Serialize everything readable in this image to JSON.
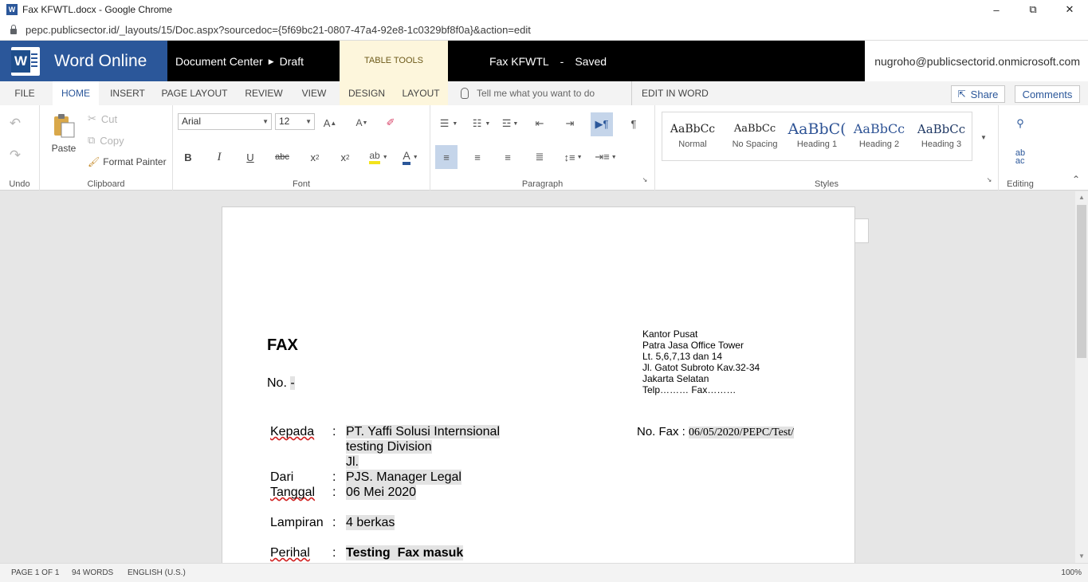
{
  "browser": {
    "tab_title": "Fax KFWTL.docx - Google Chrome",
    "url": "pepc.publicsector.id/_layouts/15/Doc.aspx?sourcedoc={5f69bc21-0807-47a4-92e8-1c0329bf8f0a}&action=edit",
    "minimize": "–",
    "restore": "⧉",
    "close": "✕"
  },
  "header": {
    "app_name": "Word Online",
    "logo_letter": "W",
    "breadcrumb": [
      "Document Center",
      "Draft"
    ],
    "table_tools": "TABLE TOOLS",
    "doc_name": "Fax KFWTL",
    "dash": "-",
    "save_status": "Saved",
    "user": "nugroho@publicsectorid.onmicrosoft.com"
  },
  "tabs": {
    "file": "FILE",
    "home": "HOME",
    "insert": "INSERT",
    "page_layout": "PAGE LAYOUT",
    "review": "REVIEW",
    "view": "VIEW",
    "design": "DESIGN",
    "layout": "LAYOUT",
    "tell_me": "Tell me what you want to do",
    "edit_in_word": "EDIT IN WORD",
    "share": "Share",
    "comments": "Comments"
  },
  "ribbon": {
    "undo_label": "Undo",
    "clipboard": {
      "paste": "Paste",
      "cut": "Cut",
      "copy": "Copy",
      "format_painter": "Format Painter",
      "label": "Clipboard"
    },
    "font": {
      "family": "Arial",
      "size": "12",
      "label": "Font",
      "bold": "B",
      "italic": "I",
      "underline": "U",
      "strike": "abc"
    },
    "paragraph_label": "Paragraph",
    "styles": {
      "label": "Styles",
      "items": [
        {
          "preview": "AaBbCc",
          "name": "Normal"
        },
        {
          "preview": "AaBbCc",
          "name": "No Spacing"
        },
        {
          "preview": "AaBbC(",
          "name": "Heading 1"
        },
        {
          "preview": "AaBbCc",
          "name": "Heading 2"
        },
        {
          "preview": "AaBbCc",
          "name": "Heading 3"
        }
      ]
    },
    "editing_label": "Editing"
  },
  "document": {
    "fax_title": "FAX",
    "no_label": "No.",
    "no_value": "-",
    "kantor": [
      "Kantor Pusat",
      "Patra Jasa Office Tower",
      "Lt. 5,6,7,13 dan 14",
      "Jl. Gatot Subroto Kav.32-34",
      "Jakarta Selatan",
      "Telp……… Fax………"
    ],
    "no_fax_label": "No. Fax :",
    "no_fax_value": "06/05/2020/PEPC/Test/",
    "colon": ":",
    "kepada_label": "Kepada",
    "kepada_lines": [
      "PT. Yaffi Solusi Internsional",
      "testing Division",
      "Jl."
    ],
    "dari_label": "Dari",
    "dari_value": "PJS. Manager Legal",
    "tanggal_label": "Tanggal",
    "tanggal_value": "06 Mei 2020",
    "lampiran_label": "Lampiran",
    "lampiran_value": "4 berkas",
    "perihal_label": "Perihal",
    "perihal_value": "Testing  Fax masuk"
  },
  "status": {
    "page": "PAGE 1 OF 1",
    "words": "94 WORDS",
    "language": "ENGLISH (U.S.)",
    "zoom": "100%"
  }
}
